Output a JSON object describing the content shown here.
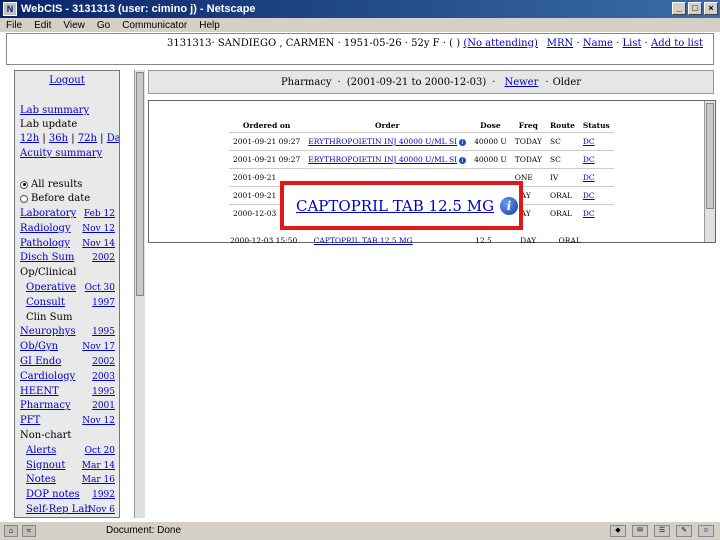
{
  "window": {
    "title": "WebCIS - 3131313 (user: cimino j) - Netscape",
    "min": "_",
    "max": "□",
    "close": "×"
  },
  "menu": [
    "File",
    "Edit",
    "View",
    "Go",
    "Communicator",
    "Help"
  ],
  "patient": {
    "mrn_id": "3131313",
    "summary": "3131313· SANDIEGO , CARMEN · 1951-05-26 · 52y F · ( )",
    "attending": "(No attending)",
    "links": [
      "MRN",
      "Name",
      "List",
      "Add to list"
    ]
  },
  "nav": {
    "logout": "Logout",
    "lab_summary": "Lab summary",
    "lab_update": "Lab update",
    "time_links": [
      "12h",
      "36h",
      "72h",
      "Days"
    ],
    "acuity": "Acuity summary",
    "radio_all": "All results",
    "radio_before": "Before date",
    "items": [
      {
        "label": "Laboratory",
        "date": "Feb 12",
        "link": true,
        "indent": false
      },
      {
        "label": "Radiology",
        "date": "Nov 12",
        "link": true,
        "indent": false
      },
      {
        "label": "Pathology",
        "date": "Nov 14",
        "link": true,
        "indent": false
      },
      {
        "label": "Disch Sum",
        "date": "2002",
        "link": true,
        "indent": false
      },
      {
        "label": "Op/Clinical",
        "date": "",
        "link": false,
        "indent": false
      },
      {
        "label": "Operative",
        "date": "Oct 30",
        "link": true,
        "indent": true
      },
      {
        "label": "Consult",
        "date": "1997",
        "link": true,
        "indent": true
      },
      {
        "label": "Clin Sum",
        "date": "",
        "link": false,
        "indent": true
      },
      {
        "label": "Neurophys",
        "date": "1995",
        "link": true,
        "indent": false
      },
      {
        "label": "Ob/Gyn",
        "date": "Nov 17",
        "link": true,
        "indent": false
      },
      {
        "label": "GI Endo",
        "date": "2002",
        "link": true,
        "indent": false
      },
      {
        "label": "Cardiology",
        "date": "2003",
        "link": true,
        "indent": false
      },
      {
        "label": "HEENT",
        "date": "1995",
        "link": true,
        "indent": false
      },
      {
        "label": "Pharmacy",
        "date": "2001",
        "link": true,
        "indent": false
      },
      {
        "label": "PFT",
        "date": "Nov 12",
        "link": true,
        "indent": false
      },
      {
        "label": "Non-chart",
        "date": "",
        "link": false,
        "indent": false
      },
      {
        "label": "Alerts",
        "date": "Oct 20",
        "link": true,
        "indent": true
      },
      {
        "label": "Signout",
        "date": "Mar 14",
        "link": true,
        "indent": true
      },
      {
        "label": "Notes",
        "date": "Mar 16",
        "link": true,
        "indent": true
      },
      {
        "label": "DOP notes",
        "date": "1992",
        "link": true,
        "indent": true
      },
      {
        "label": "Self-Rep Lab",
        "date": "Nov 6",
        "link": true,
        "indent": true
      }
    ]
  },
  "main": {
    "section": "Pharmacy",
    "range": "(2001-09-21 to 2000-12-03)",
    "sort_newer": "Newer",
    "sort_older": "Older",
    "columns": [
      "Ordered on",
      "Order",
      "Dose",
      "Freq",
      "Route",
      "Status"
    ],
    "rows": [
      {
        "ordered": "2001-09-21 09:27",
        "order": "ERYTHROPOIETIN INJ 40000 U/ML SI",
        "dose": "40000 U",
        "freq": "TODAY",
        "route": "SC",
        "status": "DC"
      },
      {
        "ordered": "2001-09-21 09:27",
        "order": "ERYTHROPOIETIN INJ 40000 U/ML SI",
        "dose": "40000 U",
        "freq": "TODAY",
        "route": "SC",
        "status": "DC"
      },
      {
        "ordered": "2001-09-21",
        "order": "",
        "dose": "",
        "freq": "ONE",
        "route": "IV",
        "status": "DC"
      },
      {
        "ordered": "2001-09-21",
        "order": "",
        "dose": "",
        "freq": "DAY",
        "route": "ORAL",
        "status": "DC"
      },
      {
        "ordered": "2000-12-03",
        "order": "",
        "dose": "",
        "freq": "DAY",
        "route": "ORAL",
        "status": "DC"
      }
    ],
    "overflow_row": {
      "ordered": "2000-12-03 15:50",
      "order": "CAPTOPRIL TAB 12.5 MG",
      "dose": "12.5",
      "freq": "DAY",
      "route": "ORAL"
    }
  },
  "callout": {
    "text": "CAPTOPRIL TAB 12.5 MG",
    "info": "i"
  },
  "status": {
    "text": "Document: Done"
  }
}
